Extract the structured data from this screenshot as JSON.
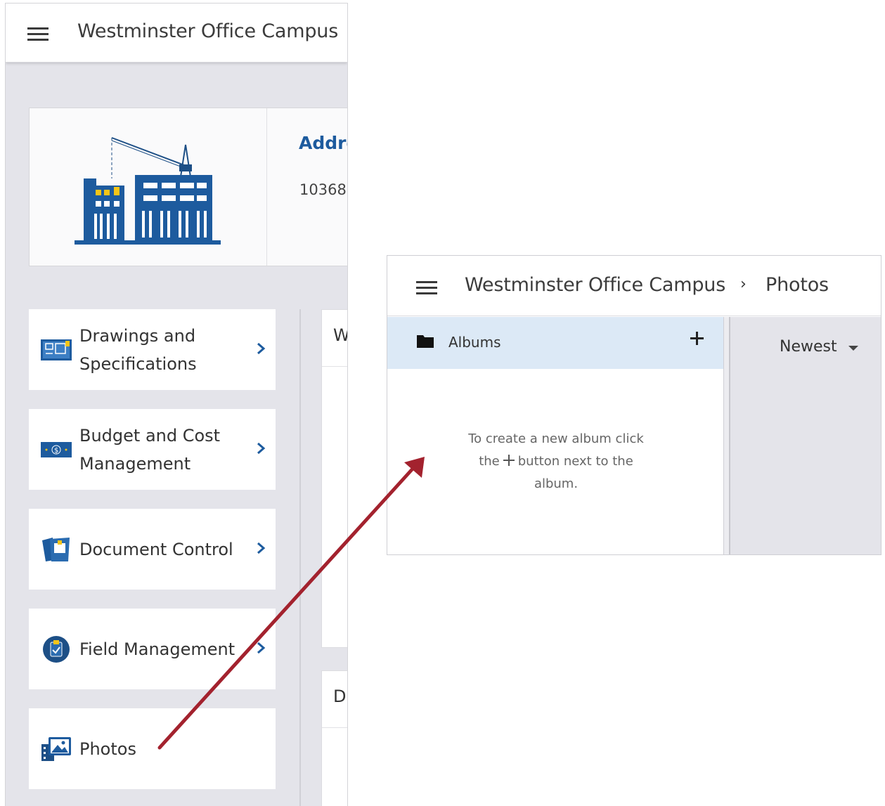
{
  "left_screen": {
    "title": "Westminster Office Campus",
    "project": {
      "address_label": "Addre",
      "address_number": "10368"
    },
    "menu": [
      {
        "label_line1": "Drawings and",
        "label_line2": "Specifications",
        "icon": "blueprint-icon"
      },
      {
        "label_line1": "Budget and Cost",
        "label_line2": "Management",
        "icon": "money-icon"
      },
      {
        "label_line1": "Document Control",
        "label_line2": "",
        "icon": "document-control-icon"
      },
      {
        "label_line1": "Field Management",
        "label_line2": "",
        "icon": "clipboard-icon"
      },
      {
        "label_line1": "Photos",
        "label_line2": "",
        "icon": "photos-icon"
      }
    ],
    "right_panels": [
      {
        "letter": "W"
      },
      {
        "letter": "D"
      }
    ]
  },
  "right_screen": {
    "breadcrumb_root": "Westminster Office Campus",
    "breadcrumb_sep": "›",
    "breadcrumb_current": "Photos",
    "albums_label": "Albums",
    "empty_line1": "To create a new album click",
    "empty_line2_a": "the",
    "empty_line2_b": "button next to the",
    "empty_line3": "album.",
    "sort_label": "Newest"
  },
  "colors": {
    "brand_blue": "#1d5b9e",
    "albums_header_bg": "#dce9f6",
    "annotation_arrow": "#a3222e"
  }
}
